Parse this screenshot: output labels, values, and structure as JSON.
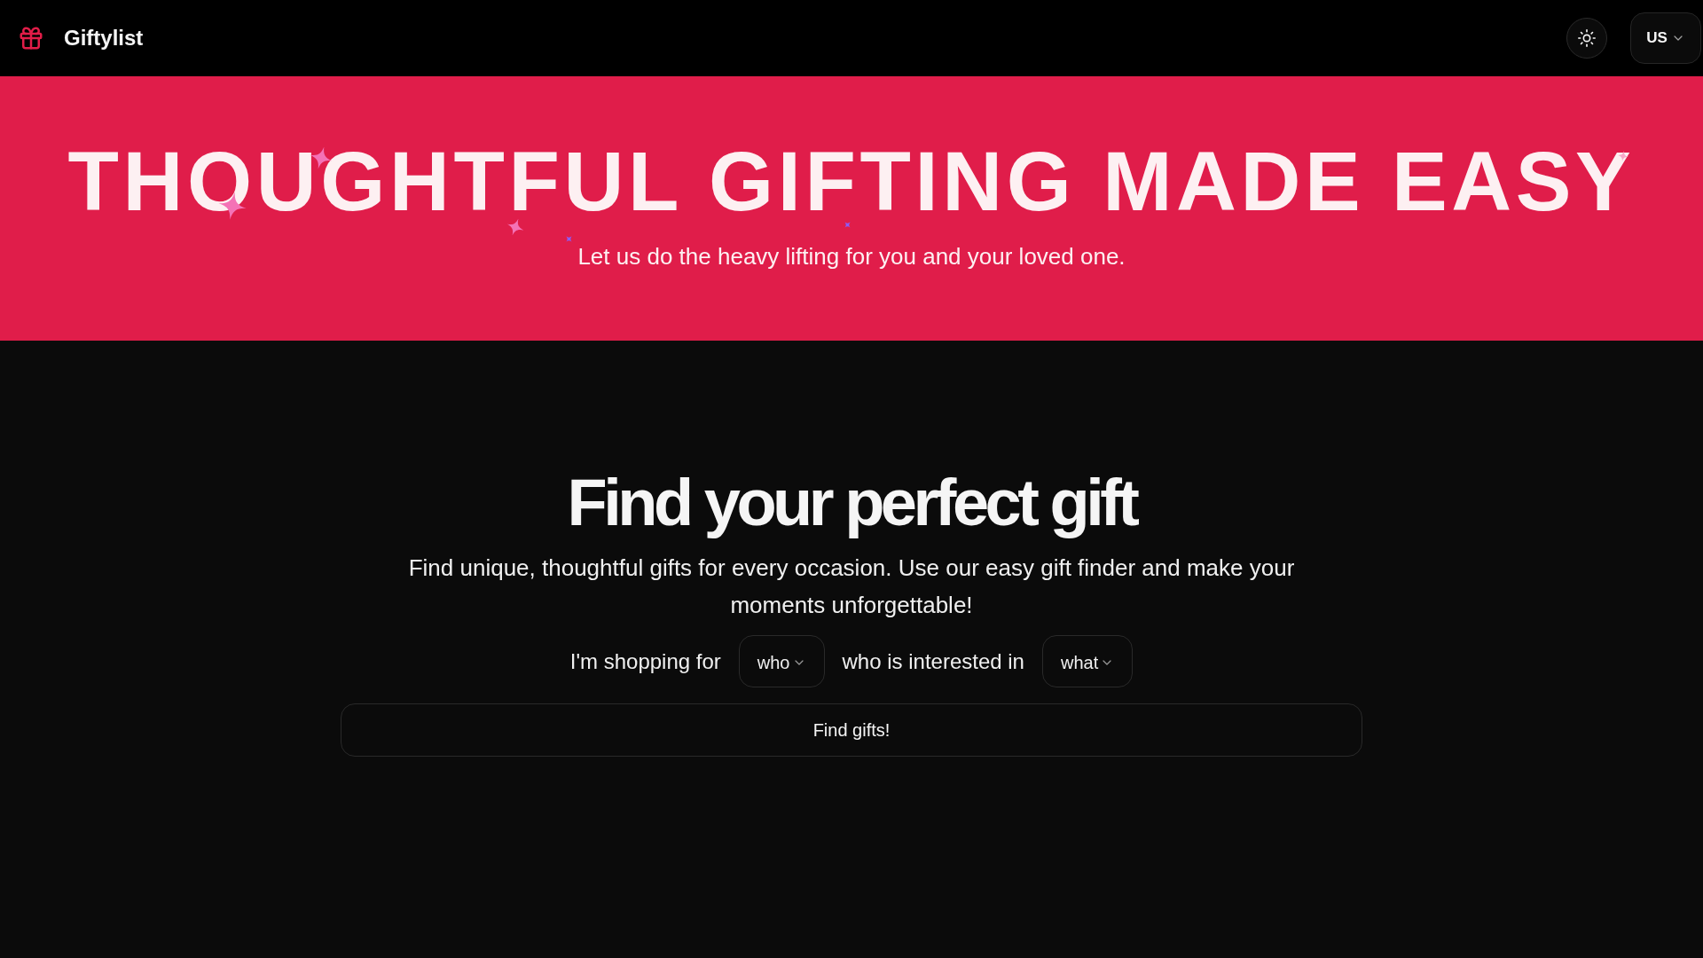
{
  "header": {
    "brand": "Giftylist",
    "region_button": {
      "label": "US"
    }
  },
  "hero": {
    "title": "THOUGHTFUL GIFTING MADE EASY",
    "subtitle": "Let us do the heavy lifting for you and your loved one."
  },
  "gift_finder": {
    "heading": "Find your perfect gift",
    "description": "Find unique, thoughtful gifts for every occasion. Use our easy gift finder and make your moments unforgettable!",
    "sentence": [
      {
        "kind": "text",
        "text": "I'm shopping for"
      },
      {
        "kind": "select",
        "placeholder": "who"
      },
      {
        "kind": "text",
        "text": "who is interested in"
      },
      {
        "kind": "select",
        "placeholder": "what"
      }
    ],
    "submit_button": "Find gifts!"
  }
}
